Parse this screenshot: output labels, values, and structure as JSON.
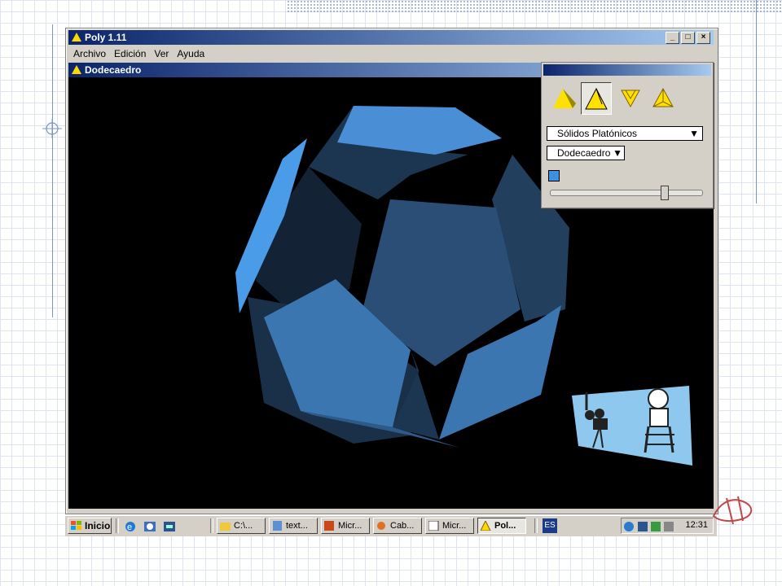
{
  "app": {
    "title": "Poly 1.11",
    "window_controls": [
      "_",
      "□",
      "×"
    ],
    "menu": [
      "Archivo",
      "Edición",
      "Ver",
      "Ayuda"
    ],
    "doc_title": "Dodecaedro"
  },
  "panel": {
    "category": "Sólidos Platónicos",
    "solid": "Dodecaedro",
    "dropdown_arrow": "▼",
    "color_swatch": "#3f8fe0",
    "slider_value": 0.76,
    "tools": [
      "solid-view-icon",
      "solid-view-selected-icon",
      "net-unfold-icon",
      "wireframe-icon"
    ]
  },
  "taskbar": {
    "start_label": "Inicio",
    "quicklaunch": [
      "ie-icon",
      "outlook-icon",
      "desktop-icon"
    ],
    "buttons": [
      {
        "label": "C:\\...",
        "icon": "folder-icon"
      },
      {
        "label": "text...",
        "icon": "document-icon"
      },
      {
        "label": "Micr...",
        "icon": "powerpoint-icon"
      },
      {
        "label": "Cab...",
        "icon": "app-icon"
      },
      {
        "label": "Micr...",
        "icon": "window-icon"
      },
      {
        "label": "Pol...",
        "icon": "poly-icon",
        "active": true
      }
    ],
    "language": "ES",
    "clock": "12:31"
  },
  "colors": {
    "face_light": "#4a9be8",
    "face_mid": "#3b76b0",
    "face_dark": "#1c3550",
    "titlebar": "#0a246a"
  }
}
